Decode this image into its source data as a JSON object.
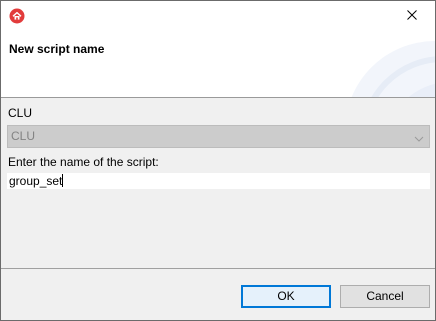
{
  "window": {
    "icon": "home-icon",
    "close_icon": "close-icon"
  },
  "header": {
    "title": "New script name"
  },
  "form": {
    "clu_label": "CLU",
    "clu_value": "CLU",
    "script_label": "Enter the name of the script:",
    "script_value": "group_set"
  },
  "buttons": {
    "ok": "OK",
    "cancel": "Cancel"
  },
  "colors": {
    "app_icon": "#e23b3b",
    "accent": "#0078d7"
  }
}
